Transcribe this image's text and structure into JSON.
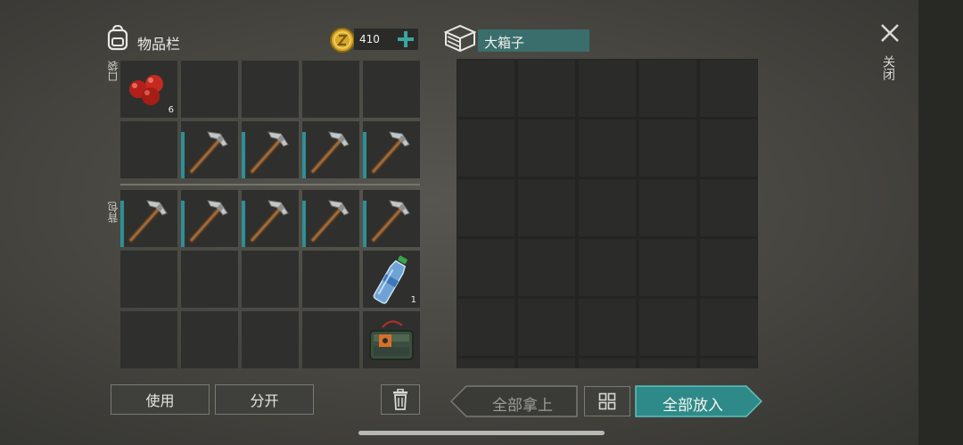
{
  "inventory": {
    "title": "物品栏",
    "coins": "410",
    "pocket_label": "口袋",
    "backpack_label": "背包",
    "slots": [
      {
        "item": "apples",
        "qty": "6"
      },
      {
        "item": "",
        "qty": ""
      },
      {
        "item": "",
        "qty": ""
      },
      {
        "item": "",
        "qty": ""
      },
      {
        "item": "",
        "qty": ""
      },
      {
        "item": "",
        "qty": ""
      },
      {
        "item": "pickaxe",
        "qty": ""
      },
      {
        "item": "pickaxe",
        "qty": ""
      },
      {
        "item": "pickaxe",
        "qty": ""
      },
      {
        "item": "pickaxe",
        "qty": ""
      }
    ],
    "backpack_slots": [
      {
        "item": "pickaxe",
        "qty": ""
      },
      {
        "item": "pickaxe",
        "qty": ""
      },
      {
        "item": "pickaxe",
        "qty": ""
      },
      {
        "item": "pickaxe",
        "qty": ""
      },
      {
        "item": "pickaxe",
        "qty": ""
      },
      {
        "item": "",
        "qty": ""
      },
      {
        "item": "",
        "qty": ""
      },
      {
        "item": "",
        "qty": ""
      },
      {
        "item": "",
        "qty": ""
      },
      {
        "item": "water-bottle",
        "qty": "1"
      },
      {
        "item": "",
        "qty": ""
      },
      {
        "item": "",
        "qty": ""
      },
      {
        "item": "",
        "qty": ""
      },
      {
        "item": "",
        "qty": ""
      },
      {
        "item": "explosive-pack",
        "qty": ""
      }
    ]
  },
  "container": {
    "name": "大箱子"
  },
  "buttons": {
    "use": "使用",
    "split": "分开",
    "take_all": "全部拿上",
    "put_all": "全部放入",
    "close": "关闭"
  },
  "icons": {
    "backpack": "backpack-icon",
    "coin": "coin-icon",
    "add": "plus-icon",
    "chest": "chest-icon",
    "close": "close-icon",
    "trash": "trash-icon",
    "sort": "sort-grid-icon"
  },
  "colors": {
    "accent": "#2f8f96",
    "container_name_bg": "#3a6e6c",
    "put_all_bg": "#2e8a89",
    "coin": "#d9a92a"
  }
}
